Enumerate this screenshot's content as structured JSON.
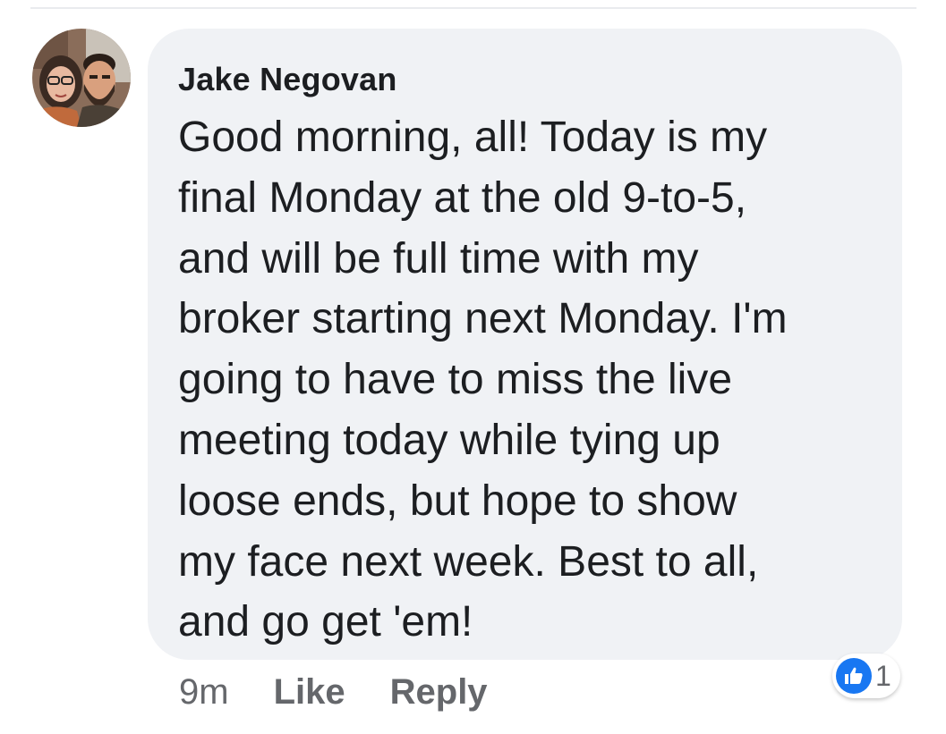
{
  "comment": {
    "author": "Jake Negovan",
    "lines": [
      "Good morning, all! Today is my",
      "final Monday at the old 9-to-5,",
      "and will be full time with my",
      "broker starting next Monday. I'm",
      "going to have to miss the live",
      "meeting today while tying up",
      "loose ends, but hope to show",
      "my face next week. Best to all,",
      "and go get 'em!"
    ],
    "timestamp": "9m",
    "like_label": "Like",
    "reply_label": "Reply",
    "reaction_count": "1",
    "reaction_icon": "thumbs-up-icon"
  },
  "colors": {
    "bubble": "#f0f2f5",
    "text": "#1c1e21",
    "muted": "#65676b",
    "like_blue": "#1877f2"
  }
}
